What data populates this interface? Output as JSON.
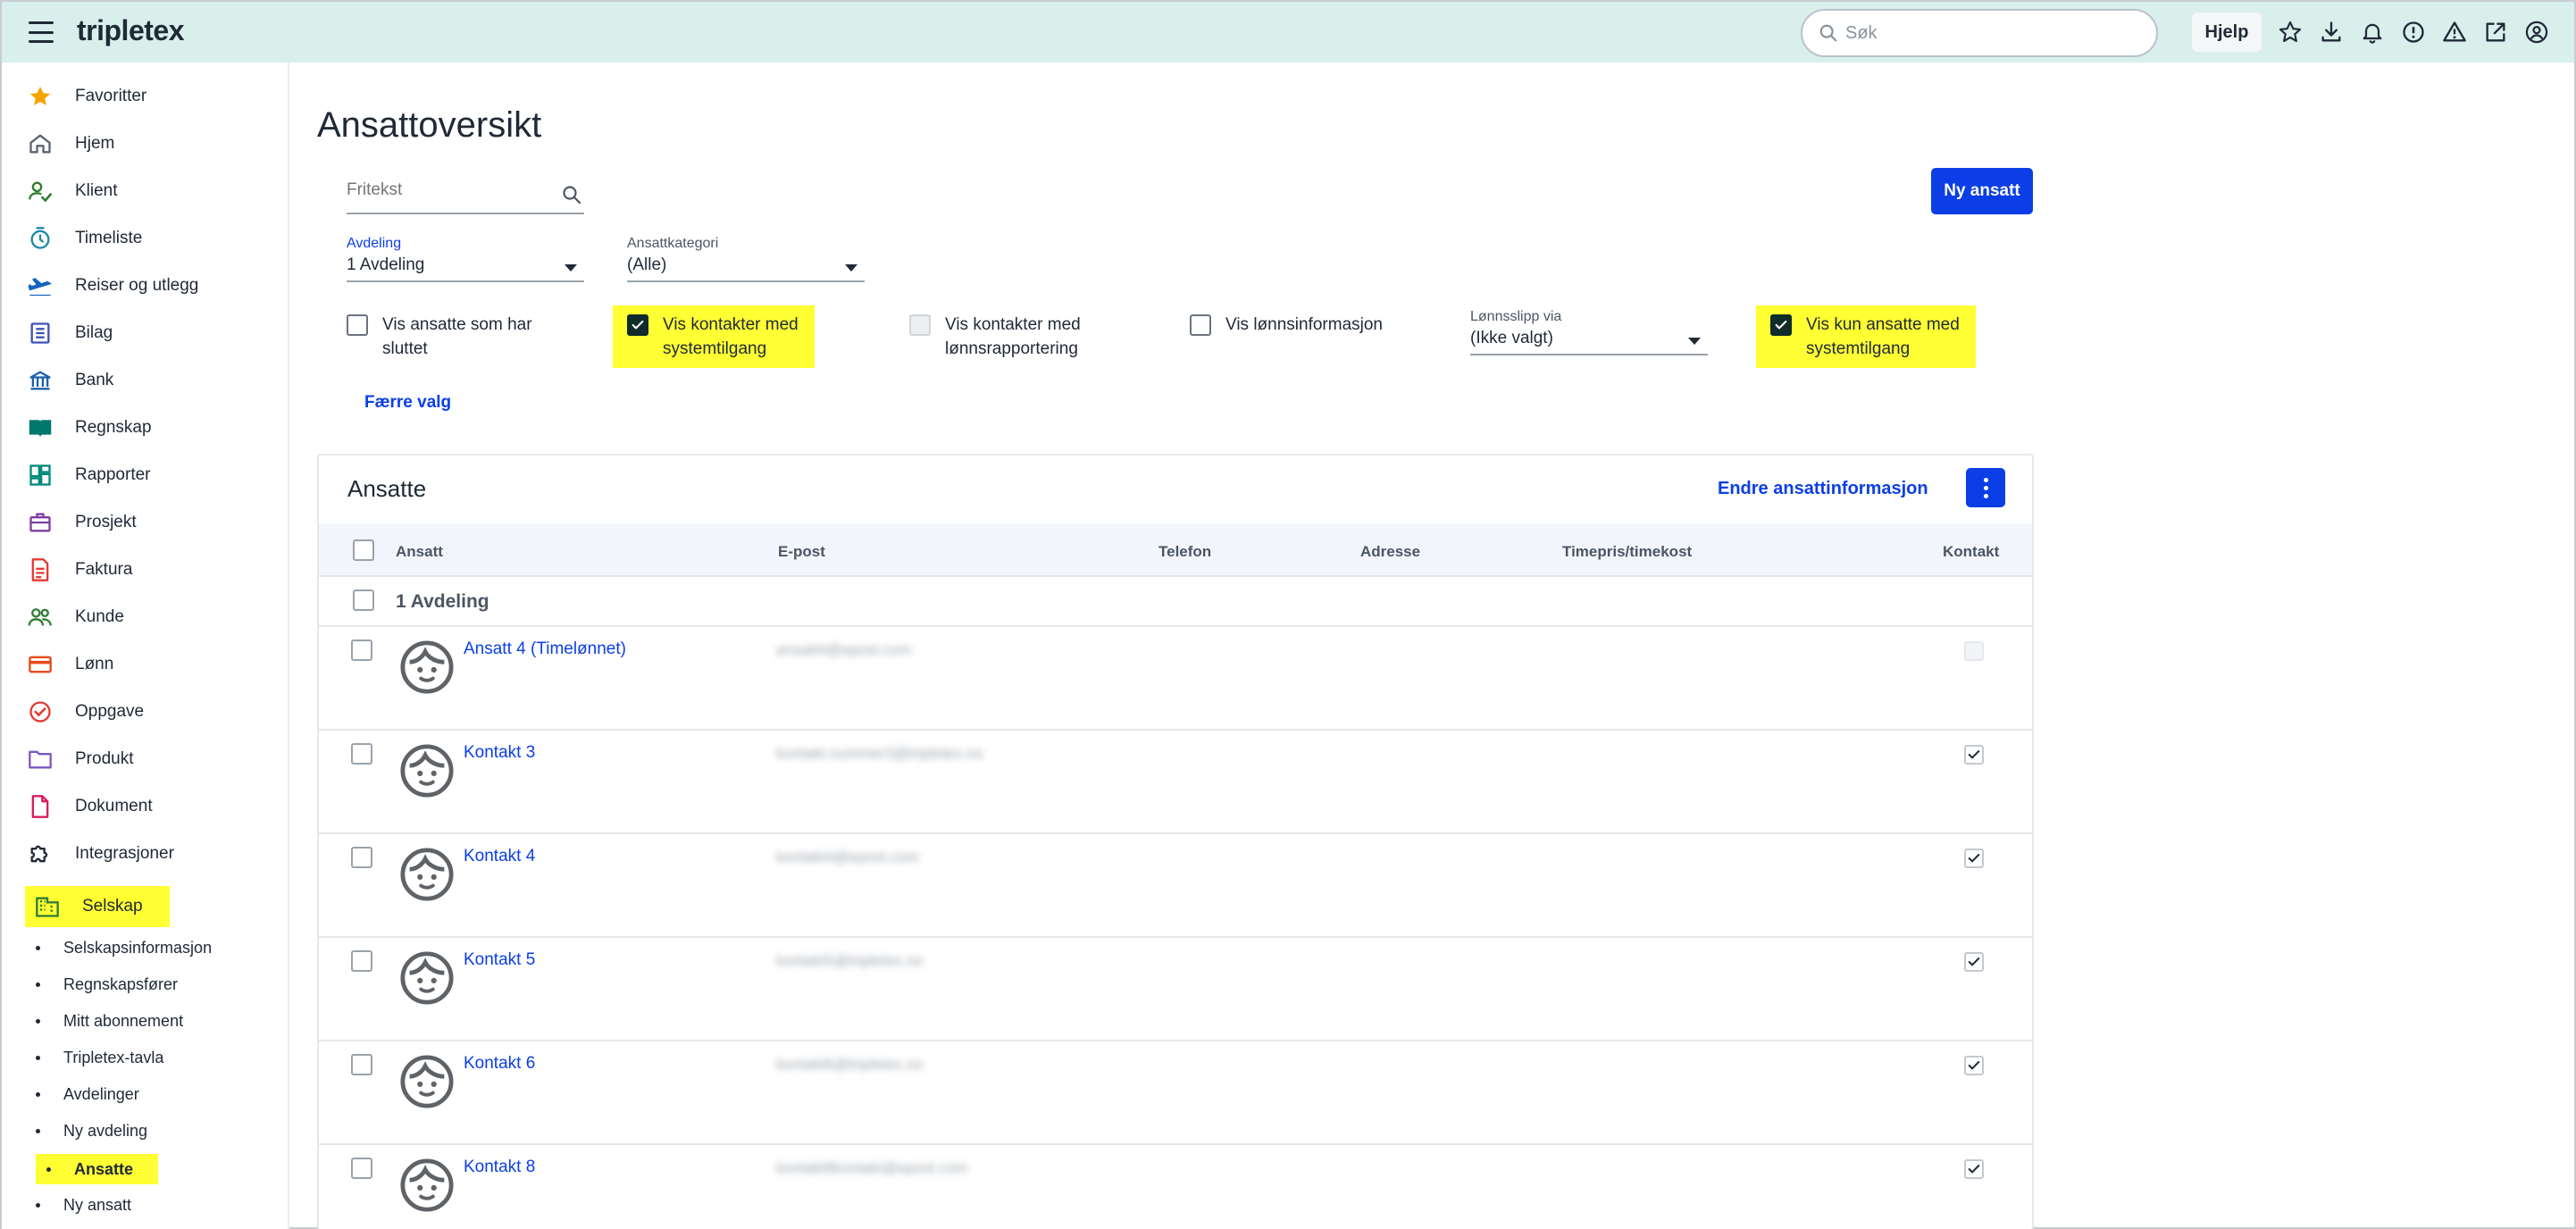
{
  "app": {
    "logo": "tripletex"
  },
  "topbar": {
    "search_placeholder": "Søk",
    "help_label": "Hjelp",
    "icons": [
      "star-icon",
      "download-icon",
      "bell-icon",
      "info-icon",
      "warning-icon",
      "external-link-icon",
      "user-icon"
    ]
  },
  "sidebar": {
    "items": [
      {
        "label": "Favoritter",
        "icon": "star-icon",
        "color": "#f5a300"
      },
      {
        "label": "Hjem",
        "icon": "home-icon",
        "color": "#5b6470"
      },
      {
        "label": "Klient",
        "icon": "client-icon",
        "color": "#2e7d32"
      },
      {
        "label": "Timeliste",
        "icon": "timer-icon",
        "color": "#1e88a8"
      },
      {
        "label": "Reiser og utlegg",
        "icon": "airplane-icon",
        "color": "#1565c0"
      },
      {
        "label": "Bilag",
        "icon": "document-list-icon",
        "color": "#3f51b5"
      },
      {
        "label": "Bank",
        "icon": "bank-icon",
        "color": "#1e5fa8"
      },
      {
        "label": "Regnskap",
        "icon": "book-icon",
        "color": "#00796b"
      },
      {
        "label": "Rapporter",
        "icon": "dashboard-icon",
        "color": "#00897b"
      },
      {
        "label": "Prosjekt",
        "icon": "briefcase-icon",
        "color": "#7b3fa0"
      },
      {
        "label": "Faktura",
        "icon": "invoice-icon",
        "color": "#e53935"
      },
      {
        "label": "Kunde",
        "icon": "people-icon",
        "color": "#2e7d32"
      },
      {
        "label": "Lønn",
        "icon": "payment-card-icon",
        "color": "#e64a19"
      },
      {
        "label": "Oppgave",
        "icon": "task-check-icon",
        "color": "#e53935"
      },
      {
        "label": "Produkt",
        "icon": "folder-icon",
        "color": "#7e57c2"
      },
      {
        "label": "Dokument",
        "icon": "file-icon",
        "color": "#d81b60"
      },
      {
        "label": "Integrasjoner",
        "icon": "puzzle-icon",
        "color": "#1f2937"
      },
      {
        "label": "Selskap",
        "icon": "building-icon",
        "color": "#2e7d32"
      }
    ],
    "subitems": [
      {
        "label": "Selskapsinformasjon"
      },
      {
        "label": "Regnskapsfører"
      },
      {
        "label": "Mitt abonnement"
      },
      {
        "label": "Tripletex-tavla"
      },
      {
        "label": "Avdelinger"
      },
      {
        "label": "Ny avdeling"
      },
      {
        "label": "Ansatte"
      },
      {
        "label": "Ny ansatt"
      }
    ]
  },
  "main": {
    "title": "Ansattoversikt",
    "new_employee_button": "Ny ansatt",
    "search_placeholder": "Fritekst",
    "filters": {
      "avdeling_label": "Avdeling",
      "avdeling_value": "1 Avdeling",
      "kategori_label": "Ansattkategori",
      "kategori_value": "(Alle)",
      "lonnsslipp_label": "Lønnsslipp via",
      "lonnsslipp_value": "(Ikke valgt)"
    },
    "checkboxes": [
      {
        "label_line1": "Vis ansatte som har",
        "label_line2": "sluttet",
        "checked": false
      },
      {
        "label_line1": "Vis kontakter med",
        "label_line2": "systemtilgang",
        "checked": true
      },
      {
        "label_line1": "Vis kontakter med",
        "label_line2": "lønnsrapportering",
        "checked": false
      },
      {
        "label_line1": "Vis lønnsinformasjon",
        "label_line2": "",
        "checked": false
      },
      {
        "label_line1": "Vis kun ansatte med",
        "label_line2": "systemtilgang",
        "checked": true
      }
    ],
    "fewer_options_link": "Færre valg"
  },
  "table": {
    "title": "Ansatte",
    "edit_link": "Endre ansattinformasjon",
    "columns": [
      "Ansatt",
      "E-post",
      "Telefon",
      "Adresse",
      "Timepris/timekost",
      "Kontakt"
    ],
    "group": "1 Avdeling",
    "rows": [
      {
        "name": "Ansatt 4 (Timelønnet)",
        "email": "ansatt4@epost.com",
        "contact": false
      },
      {
        "name": "Kontakt 3",
        "email": "kontakt.nummer3@tripletex.no",
        "contact": true
      },
      {
        "name": "Kontakt 4",
        "email": "kontakt4@epost.com",
        "contact": true
      },
      {
        "name": "Kontakt 5",
        "email": "kontakt5@tripletex.no",
        "contact": true
      },
      {
        "name": "Kontakt 6",
        "email": "kontakt6@tripletex.no",
        "contact": true
      },
      {
        "name": "Kontakt 8",
        "email": "kontakt8kontakt@epost.com",
        "contact": true
      }
    ]
  },
  "colors": {
    "topbar_bg": "#d9efec",
    "primary_blue": "#0b3ee6",
    "highlight": "#ffff33",
    "checked_box": "#0f2c2a"
  }
}
